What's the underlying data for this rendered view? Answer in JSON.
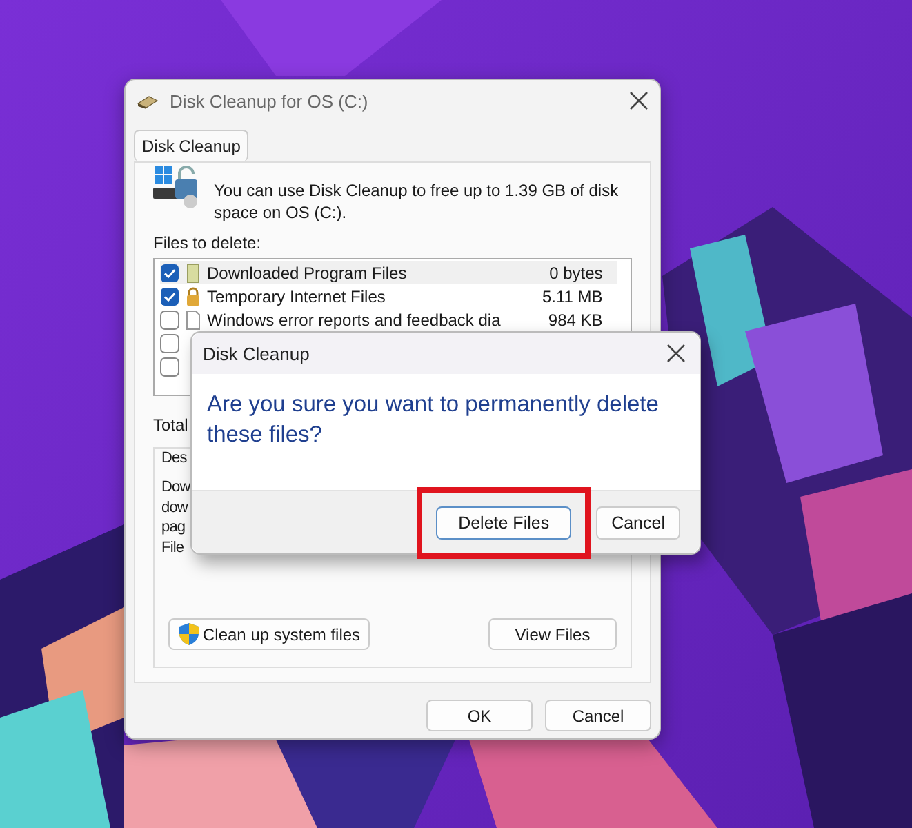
{
  "window": {
    "title": "Disk Cleanup for OS (C:)",
    "tabs": [
      {
        "label": "Disk Cleanup",
        "selected": true
      }
    ],
    "intro": "You can use Disk Cleanup to free up to 1.39 GB of disk space on OS (C:).",
    "files_label": "Files to delete:",
    "files": [
      {
        "name": "Downloaded Program Files",
        "size": "0 bytes",
        "checked": true
      },
      {
        "name": "Temporary Internet Files",
        "size": "5.11 MB",
        "checked": true
      },
      {
        "name": "Windows error reports and feedback dia",
        "size": "984 KB",
        "checked": false
      },
      {
        "checked": false
      },
      {
        "checked": false
      }
    ],
    "total_label": "Total",
    "description_label": "Des",
    "description_lines": [
      "Dow",
      "dow",
      "pag",
      "File"
    ],
    "buttons": [
      {
        "label": "Clean up system files",
        "kind": "shield"
      },
      {
        "label": "View Files",
        "kind": "plain"
      }
    ],
    "footer_buttons": [
      "OK",
      "Cancel"
    ]
  },
  "dialog": {
    "title": "Disk Cleanup",
    "message": "Are you sure you want to permanently delete these files?",
    "buttons": [
      {
        "label": "Delete Files",
        "default": true,
        "highlighted": true
      },
      {
        "label": "Cancel",
        "default": false,
        "highlighted": false
      }
    ]
  }
}
